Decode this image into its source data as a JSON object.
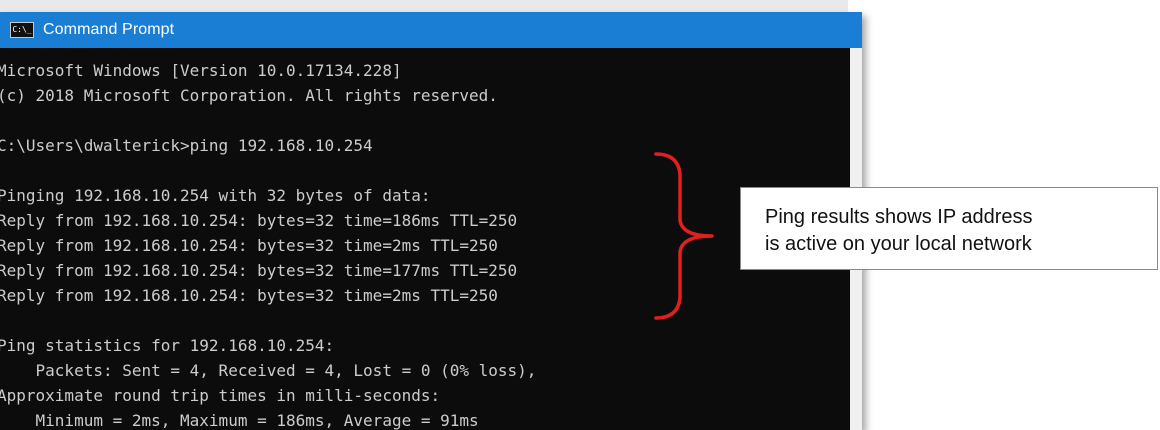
{
  "window": {
    "title": "Command Prompt",
    "icon": "C:\\_"
  },
  "console": {
    "lines": [
      "Microsoft Windows [Version 10.0.17134.228]",
      "(c) 2018 Microsoft Corporation. All rights reserved.",
      "",
      "C:\\Users\\dwalterick>ping 192.168.10.254",
      "",
      "Pinging 192.168.10.254 with 32 bytes of data:",
      "Reply from 192.168.10.254: bytes=32 time=186ms TTL=250",
      "Reply from 192.168.10.254: bytes=32 time=2ms TTL=250",
      "Reply from 192.168.10.254: bytes=32 time=177ms TTL=250",
      "Reply from 192.168.10.254: bytes=32 time=2ms TTL=250",
      "",
      "Ping statistics for 192.168.10.254:",
      "    Packets: Sent = 4, Received = 4, Lost = 0 (0% loss),",
      "Approximate round trip times in milli-seconds:",
      "    Minimum = 2ms, Maximum = 186ms, Average = 91ms"
    ]
  },
  "annotation": {
    "callout_lines": [
      "Ping results shows IP address",
      "is active on your local network"
    ],
    "bracket_color": "#e02020"
  },
  "colors": {
    "title_bar": "#1a7fd4",
    "console_bg": "#0c0c0c",
    "console_text": "#cccccc"
  }
}
